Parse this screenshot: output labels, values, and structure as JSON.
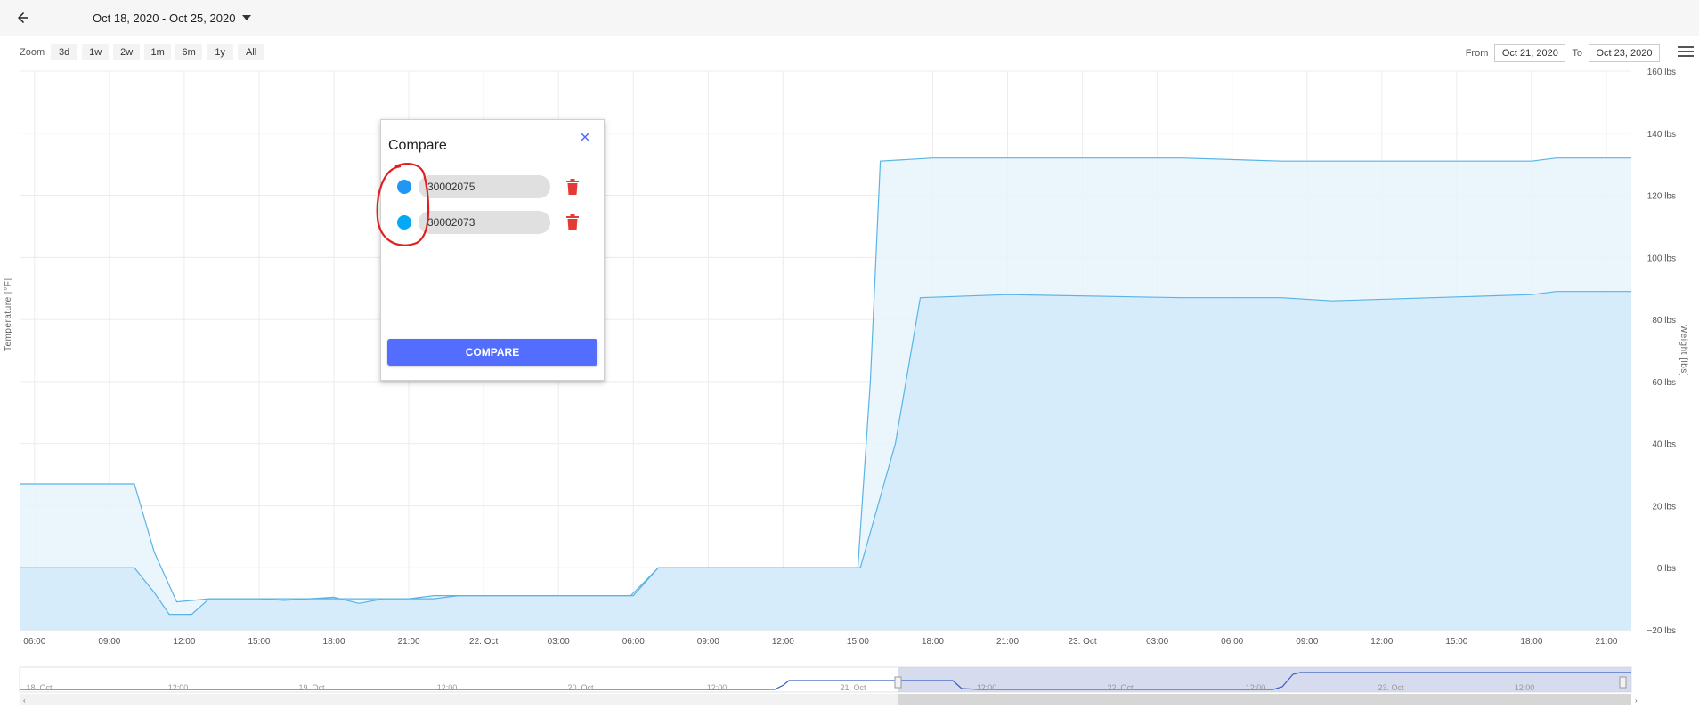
{
  "header": {
    "back_icon": "arrow-left-icon",
    "date_range": "Oct 18, 2020 - Oct 25, 2020",
    "dropdown_icon": "caret-down-icon"
  },
  "toolbar": {
    "zoom_label": "Zoom",
    "zoom_options": [
      "3d",
      "1w",
      "2w",
      "1m",
      "6m",
      "1y",
      "All"
    ],
    "from_label": "From",
    "from_value": "Oct 21, 2020",
    "to_label": "To",
    "to_value": "Oct 23, 2020",
    "menu_icon": "hamburger-menu-icon"
  },
  "chart_data": {
    "type": "area",
    "ylabel": "Temperature [°F]",
    "y2label": "Weight [lbs]",
    "y2_ticks": [
      "160 lbs",
      "140 lbs",
      "120 lbs",
      "100 lbs",
      "80 lbs",
      "60 lbs",
      "40 lbs",
      "20 lbs",
      "0 lbs",
      "−20 lbs"
    ],
    "y2lim": [
      -20,
      160
    ],
    "x_ticks": [
      "06:00",
      "09:00",
      "12:00",
      "15:00",
      "18:00",
      "21:00",
      "22. Oct",
      "03:00",
      "06:00",
      "09:00",
      "12:00",
      "15:00",
      "18:00",
      "21:00",
      "23. Oct",
      "03:00",
      "06:00",
      "09:00",
      "12:00",
      "15:00",
      "18:00",
      "21:00"
    ],
    "xlim_hours": [
      5.4,
      70
    ],
    "grid": true,
    "series": [
      {
        "color": "#5ab4e6",
        "fill": "#e6f3fc",
        "points": [
          [
            5.4,
            27
          ],
          [
            10,
            27
          ],
          [
            10.8,
            5
          ],
          [
            11.7,
            -11
          ],
          [
            13,
            -10
          ],
          [
            16,
            -10
          ],
          [
            18,
            -10
          ],
          [
            21,
            -10
          ],
          [
            22,
            -9
          ],
          [
            27,
            -9
          ],
          [
            29.9,
            -9
          ],
          [
            31,
            0
          ],
          [
            38,
            0
          ],
          [
            39,
            0
          ],
          [
            39.5,
            60
          ],
          [
            39.9,
            131
          ],
          [
            42,
            132
          ],
          [
            45,
            132
          ],
          [
            52,
            132
          ],
          [
            56,
            131
          ],
          [
            62,
            131
          ],
          [
            66,
            131
          ],
          [
            67,
            132
          ],
          [
            70,
            132
          ]
        ]
      },
      {
        "color": "#5ab4e6",
        "fill": "#d4eaf9",
        "points": [
          [
            5.4,
            0
          ],
          [
            10,
            0
          ],
          [
            10.8,
            -8
          ],
          [
            11.4,
            -15
          ],
          [
            12.3,
            -15
          ],
          [
            13,
            -10
          ],
          [
            15,
            -10
          ],
          [
            16,
            -10.5
          ],
          [
            17,
            -10
          ],
          [
            18,
            -9.5
          ],
          [
            19,
            -11.5
          ],
          [
            20,
            -10
          ],
          [
            22,
            -10
          ],
          [
            23,
            -9
          ],
          [
            28,
            -9
          ],
          [
            30,
            -9
          ],
          [
            31,
            0
          ],
          [
            38,
            0
          ],
          [
            39.1,
            0
          ],
          [
            40.5,
            40
          ],
          [
            41.5,
            87
          ],
          [
            45,
            88
          ],
          [
            52,
            87
          ],
          [
            56,
            87
          ],
          [
            58,
            86
          ],
          [
            62,
            87
          ],
          [
            66,
            88
          ],
          [
            67,
            89
          ],
          [
            70,
            89
          ]
        ]
      }
    ]
  },
  "navigator": {
    "labels": [
      "18. Oct",
      "12:00",
      "19. Oct",
      "12:00",
      "20. Oct",
      "12:00",
      "21. Oct",
      "12:00",
      "22. Oct",
      "12:00",
      "23. Oct",
      "12:00"
    ],
    "line_color": "#3b5fc0",
    "mask_color": "#c8cfe8",
    "selected_range": [
      "Oct 21, 2020",
      "Oct 23, 2020"
    ]
  },
  "compare_dialog": {
    "title": "Compare",
    "close_icon": "close-icon",
    "items": [
      {
        "value": "30002075",
        "dot_color": "#2196f3",
        "delete_icon": "trash-icon"
      },
      {
        "value": "30002073",
        "dot_color": "#03a9f4",
        "delete_icon": "trash-icon"
      }
    ],
    "button_label": "COMPARE"
  },
  "colors": {
    "accent": "#536dfe",
    "delete": "#e53935",
    "annotation": "#e02020"
  }
}
